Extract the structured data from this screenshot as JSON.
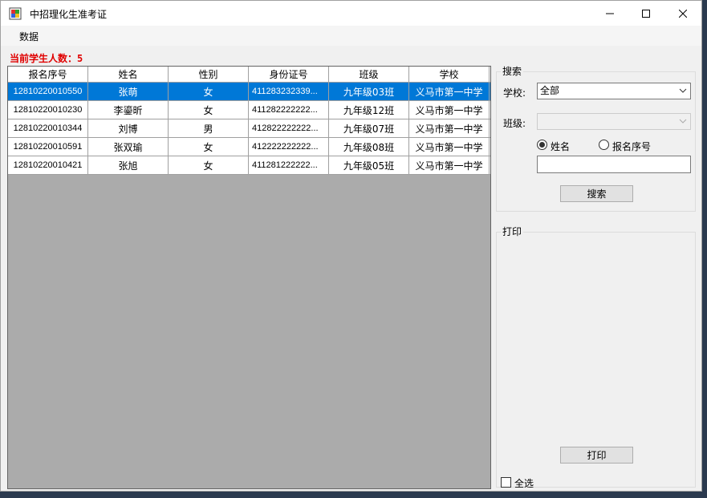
{
  "window": {
    "title": "中招理化生准考证"
  },
  "menu": {
    "items": [
      "数据"
    ]
  },
  "status": {
    "count_label": "当前学生人数：",
    "count_value": "5"
  },
  "table": {
    "columns": [
      "报名序号",
      "姓名",
      "性别",
      "身份证号",
      "班级",
      "学校"
    ],
    "rows": [
      [
        "12810220010550",
        "张萌",
        "女",
        "411283232339...",
        "九年级03班",
        "义马市第一中学"
      ],
      [
        "12810220010230",
        "李鎏昕",
        "女",
        "411282222222...",
        "九年级12班",
        "义马市第一中学"
      ],
      [
        "12810220010344",
        "刘博",
        "男",
        "412822222222...",
        "九年级07班",
        "义马市第一中学"
      ],
      [
        "12810220010591",
        "张双瑜",
        "女",
        "412222222222...",
        "九年级08班",
        "义马市第一中学"
      ],
      [
        "12810220010421",
        "张旭",
        "女",
        "411281222222...",
        "九年级05班",
        "义马市第一中学"
      ]
    ],
    "selected_row": 0
  },
  "search": {
    "group_title": "搜索",
    "school_label": "学校:",
    "school_value": "全部",
    "class_label": "班级:",
    "class_value": "",
    "radio_name": "姓名",
    "radio_id": "报名序号",
    "query_value": "",
    "search_button": "搜索"
  },
  "print": {
    "group_title": "打印",
    "print_button": "打印",
    "select_all": "全选"
  },
  "colors": {
    "selection": "#0078d7",
    "count_text": "#e00000"
  }
}
